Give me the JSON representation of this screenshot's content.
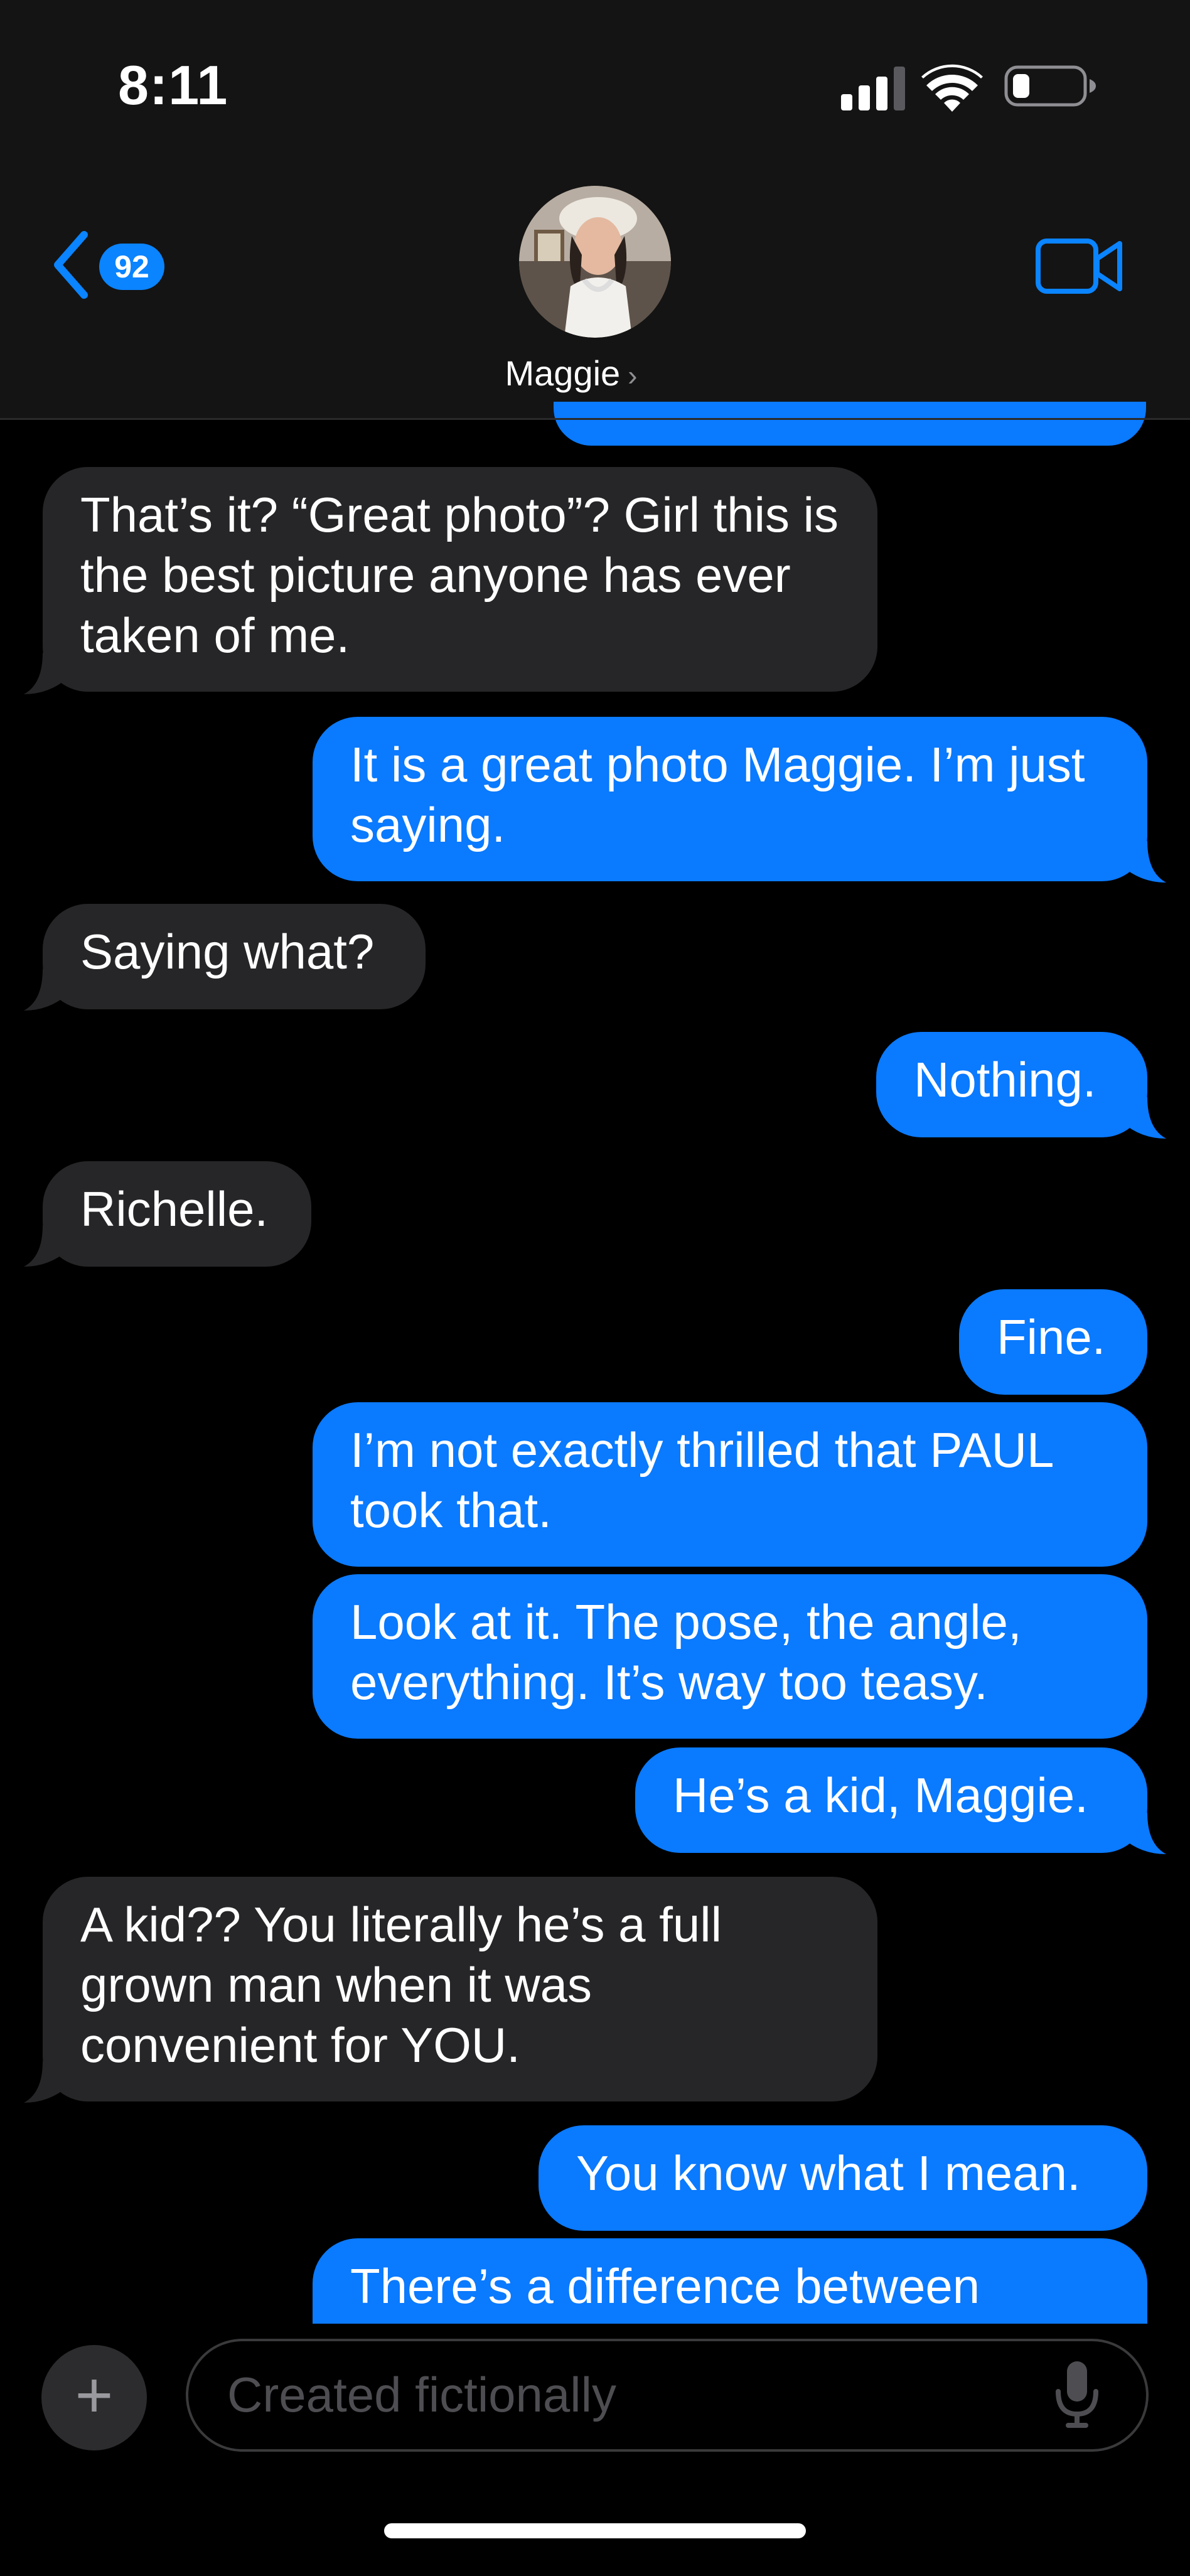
{
  "status_bar": {
    "time": "8:11"
  },
  "header": {
    "unread_count": "92",
    "contact_name": "Maggie"
  },
  "messages": [
    {
      "from": "them",
      "text": "That’s it? “Great photo”? Girl this is the best picture anyone has ever taken of me."
    },
    {
      "from": "me",
      "text": "It is a great photo Maggie. I’m just saying."
    },
    {
      "from": "them",
      "text": "Saying what?"
    },
    {
      "from": "me",
      "text": "Nothing."
    },
    {
      "from": "them",
      "text": "Richelle."
    },
    {
      "from": "me",
      "text": "Fine."
    },
    {
      "from": "me",
      "text": "I’m not exactly thrilled that PAUL took that."
    },
    {
      "from": "me",
      "text": "Look at it. The pose, the angle, everything. It’s way too teasy."
    },
    {
      "from": "me",
      "text": "He’s a kid, Maggie."
    },
    {
      "from": "them",
      "text": "A kid?? You literally he’s a full grown man when it was convenient for YOU."
    },
    {
      "from": "me",
      "text": "You know what I mean."
    },
    {
      "from": "me",
      "text": "There’s a difference between"
    }
  ],
  "composer": {
    "placeholder": "Created fictionally"
  },
  "colors": {
    "outgoing": "#0a7aff",
    "incoming": "#262628",
    "accent": "#0a84ff"
  }
}
